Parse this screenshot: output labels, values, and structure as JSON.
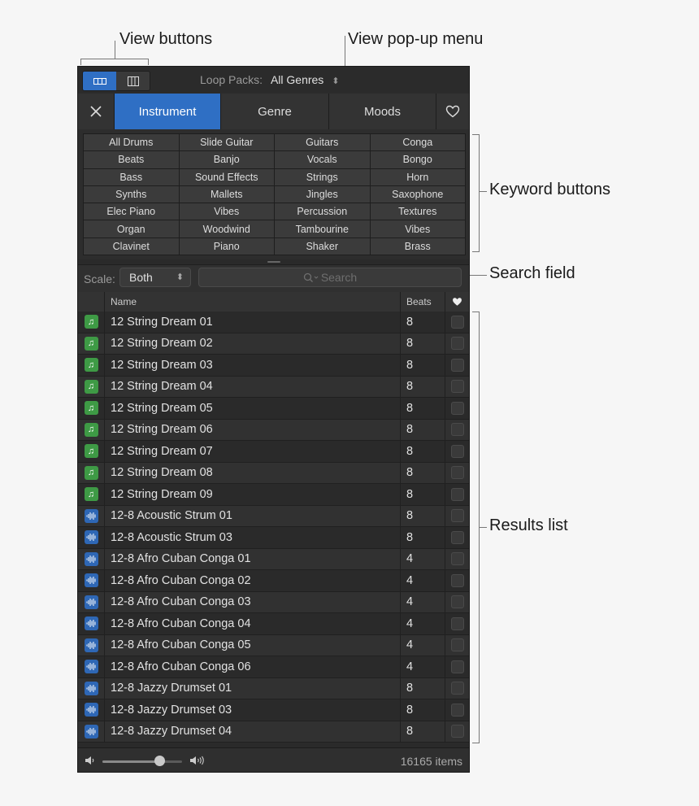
{
  "callouts": {
    "view_buttons": "View buttons",
    "view_popup": "View pop-up menu",
    "keyword_buttons": "Keyword buttons",
    "search_field": "Search field",
    "results_list": "Results list"
  },
  "topbar": {
    "loop_packs_label": "Loop Packs:",
    "loop_packs_value": "All Genres"
  },
  "tabs": [
    "Instrument",
    "Genre",
    "Moods"
  ],
  "keywords": [
    [
      "All Drums",
      "Slide Guitar",
      "Guitars",
      "Conga"
    ],
    [
      "Beats",
      "Banjo",
      "Vocals",
      "Bongo"
    ],
    [
      "Bass",
      "Sound Effects",
      "Strings",
      "Horn"
    ],
    [
      "Synths",
      "Mallets",
      "Jingles",
      "Saxophone"
    ],
    [
      "Elec Piano",
      "Vibes",
      "Percussion",
      "Textures"
    ],
    [
      "Organ",
      "Woodwind",
      "Tambourine",
      "Vibes"
    ],
    [
      "Clavinet",
      "Piano",
      "Shaker",
      "Brass"
    ]
  ],
  "search": {
    "scale_label": "Scale:",
    "scale_value": "Both",
    "placeholder": "Search"
  },
  "columns": {
    "name": "Name",
    "beats": "Beats"
  },
  "rows": [
    {
      "icon": "midi",
      "name": "12 String Dream 01",
      "beats": "8"
    },
    {
      "icon": "midi",
      "name": "12 String Dream 02",
      "beats": "8"
    },
    {
      "icon": "midi",
      "name": "12 String Dream 03",
      "beats": "8"
    },
    {
      "icon": "midi",
      "name": "12 String Dream 04",
      "beats": "8"
    },
    {
      "icon": "midi",
      "name": "12 String Dream 05",
      "beats": "8"
    },
    {
      "icon": "midi",
      "name": "12 String Dream 06",
      "beats": "8"
    },
    {
      "icon": "midi",
      "name": "12 String Dream 07",
      "beats": "8"
    },
    {
      "icon": "midi",
      "name": "12 String Dream 08",
      "beats": "8"
    },
    {
      "icon": "midi",
      "name": "12 String Dream 09",
      "beats": "8"
    },
    {
      "icon": "audio",
      "name": "12-8 Acoustic Strum 01",
      "beats": "8"
    },
    {
      "icon": "audio",
      "name": "12-8 Acoustic Strum 03",
      "beats": "8"
    },
    {
      "icon": "audio",
      "name": "12-8 Afro Cuban Conga 01",
      "beats": "4"
    },
    {
      "icon": "audio",
      "name": "12-8 Afro Cuban Conga 02",
      "beats": "4"
    },
    {
      "icon": "audio",
      "name": "12-8 Afro Cuban Conga 03",
      "beats": "4"
    },
    {
      "icon": "audio",
      "name": "12-8 Afro Cuban Conga 04",
      "beats": "4"
    },
    {
      "icon": "audio",
      "name": "12-8 Afro Cuban Conga 05",
      "beats": "4"
    },
    {
      "icon": "audio",
      "name": "12-8 Afro Cuban Conga 06",
      "beats": "4"
    },
    {
      "icon": "audio",
      "name": "12-8 Jazzy Drumset 01",
      "beats": "8"
    },
    {
      "icon": "audio",
      "name": "12-8 Jazzy Drumset 03",
      "beats": "8"
    },
    {
      "icon": "audio",
      "name": "12-8 Jazzy Drumset 04",
      "beats": "8"
    }
  ],
  "footer": {
    "volume_level": 0.72,
    "count": "16165 items"
  },
  "colors": {
    "accent": "#2f6fc4",
    "midi_icon": "#3e9a45",
    "audio_icon": "#2e67b5"
  }
}
